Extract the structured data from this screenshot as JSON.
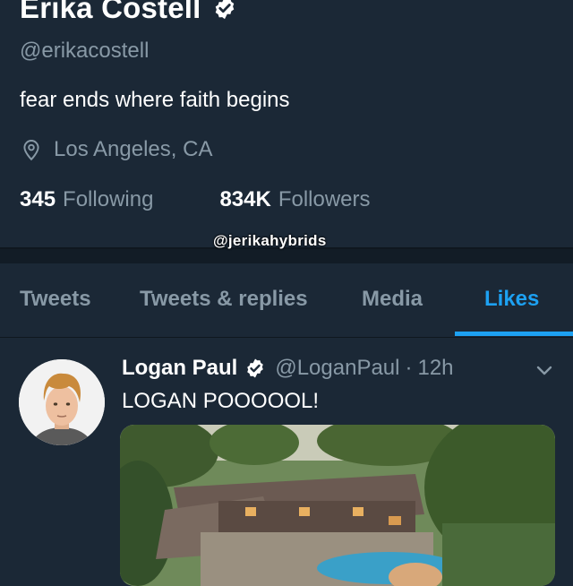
{
  "profile": {
    "name": "Erika Costell",
    "handle": "@erikacostell",
    "bio": "fear ends where faith begins",
    "location": "Los Angeles, CA",
    "following_count": "345",
    "following_label": "Following",
    "followers_count": "834K",
    "followers_label": "Followers"
  },
  "watermark": "@jerikahybrids",
  "tabs": [
    {
      "label": "Tweets"
    },
    {
      "label": "Tweets & replies"
    },
    {
      "label": "Media"
    },
    {
      "label": "Likes"
    }
  ],
  "tweet": {
    "author": "Logan Paul",
    "handle": "@LoganPaul",
    "separator": "·",
    "time": "12h",
    "text": "LOGAN POOOOOL!"
  },
  "colors": {
    "background": "#1b2836",
    "accent": "#1da1f2",
    "muted": "#8899a6"
  }
}
